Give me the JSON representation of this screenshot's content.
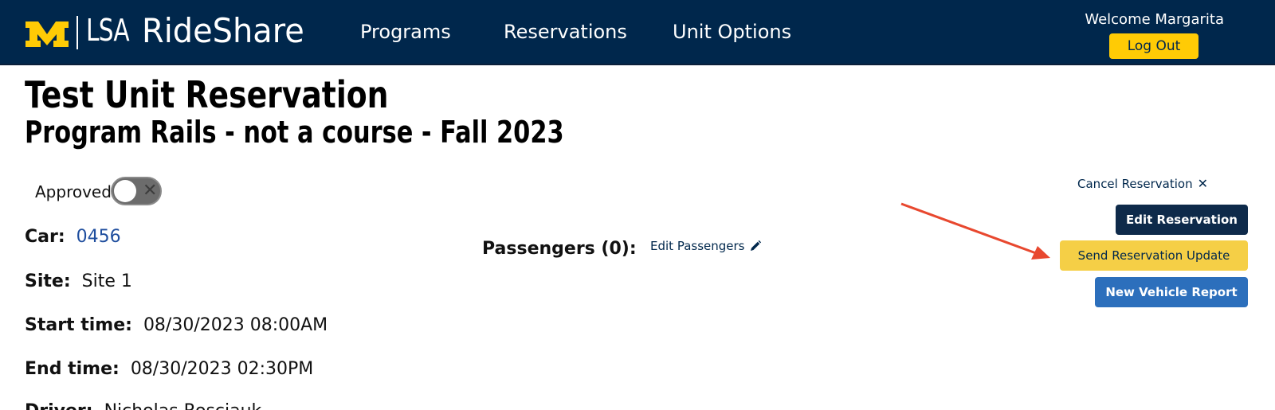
{
  "header": {
    "logo_mark": "M",
    "logo_sub": "LSA",
    "brand": "RideShare",
    "nav": [
      "Programs",
      "Reservations",
      "Unit Options"
    ],
    "welcome": "Welcome Margarita",
    "logout_label": "Log Out"
  },
  "page": {
    "title": "Test Unit Reservation",
    "subtitle": "Program Rails - not a course - Fall 2023"
  },
  "status": {
    "approved_label": "Approved",
    "approved": false
  },
  "details": {
    "car_label": "Car:",
    "car_value": "0456",
    "site_label": "Site:",
    "site_value": "Site 1",
    "start_label": "Start time:",
    "start_value": "08/30/2023 08:00AM",
    "end_label": "End time:",
    "end_value": "08/30/2023 02:30PM",
    "driver_label": "Driver:",
    "driver_value": "Nicholas Rosciauk"
  },
  "passengers": {
    "label": "Passengers (0):",
    "edit_label": "Edit Passengers"
  },
  "actions": {
    "cancel_label": "Cancel Reservation",
    "edit_label": "Edit Reservation",
    "send_label": "Send Reservation Update",
    "report_label": "New Vehicle Report"
  },
  "colors": {
    "header_bg": "#00274c",
    "maize": "#ffcb05",
    "annotation_arrow": "#e8482f"
  },
  "icons": {
    "pencil": "pencil-icon",
    "cancel": "close-icon",
    "toggle_off": "x-icon"
  }
}
